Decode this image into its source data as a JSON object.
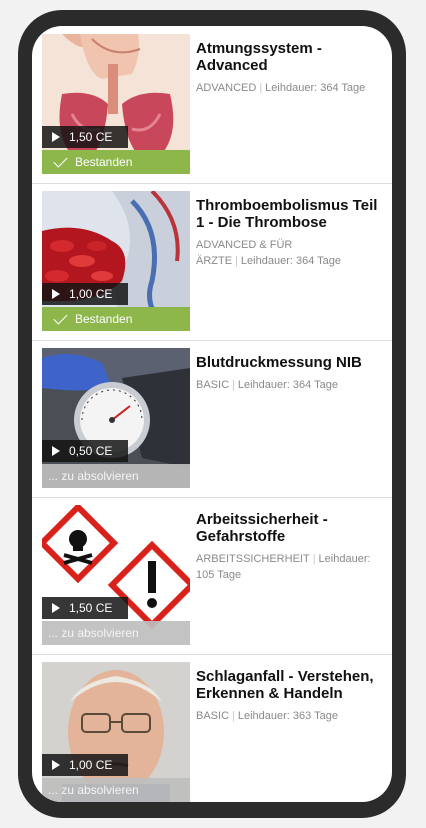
{
  "courses": [
    {
      "title": "Atmungssystem - Advanced",
      "level": "ADVANCED",
      "duration": "Leihdauer: 364 Tage",
      "ce": "1,50 CE",
      "status": "Bestanden",
      "status_type": "passed",
      "image": "respiratory-anatomy"
    },
    {
      "title": "Thromboembolismus Teil 1 - Die Thrombose",
      "level": "ADVANCED & FÜR ÄRZTE",
      "duration": "Leihdauer: 364 Tage",
      "ce": "1,00 CE",
      "status": "Bestanden",
      "status_type": "passed",
      "image": "blood-clot"
    },
    {
      "title": "Blutdruckmessung NIB",
      "level": "BASIC",
      "duration": "Leihdauer: 364 Tage",
      "ce": "0,50 CE",
      "status": "... zu absolvieren",
      "status_type": "pending",
      "image": "blood-pressure-gauge"
    },
    {
      "title": "Arbeitssicherheit - Gefahrstoffe",
      "level": "ARBEITSSICHERHEIT",
      "duration": "Leihdauer: 105 Tage",
      "ce": "1,50 CE",
      "status": "... zu absolvieren",
      "status_type": "pending",
      "image": "hazard-symbols"
    },
    {
      "title": "Schlaganfall - Verstehen, Erkennen & Handeln",
      "level": "BASIC",
      "duration": "Leihdauer: 363 Tage",
      "ce": "1,00 CE",
      "status": "... zu absolvieren",
      "status_type": "pending",
      "image": "elderly-man"
    }
  ],
  "colors": {
    "passed": "#8db74a",
    "pending": "#bebebe",
    "frame": "#2b2b2b"
  }
}
